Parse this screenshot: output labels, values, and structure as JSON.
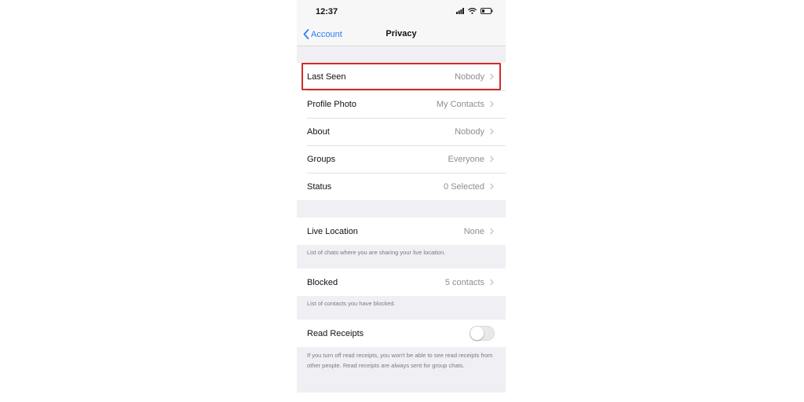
{
  "status_bar": {
    "time": "12:37"
  },
  "nav": {
    "back_label": "Account",
    "title": "Privacy"
  },
  "rows_group1": [
    {
      "label": "Last Seen",
      "value": "Nobody"
    },
    {
      "label": "Profile Photo",
      "value": "My Contacts"
    },
    {
      "label": "About",
      "value": "Nobody"
    },
    {
      "label": "Groups",
      "value": "Everyone"
    },
    {
      "label": "Status",
      "value": "0 Selected"
    }
  ],
  "live_location": {
    "label": "Live Location",
    "value": "None",
    "note": "List of chats where you are sharing your live location."
  },
  "blocked": {
    "label": "Blocked",
    "value": "5 contacts",
    "note": "List of contacts you have blocked."
  },
  "read_receipts": {
    "label": "Read Receipts",
    "enabled": false,
    "note": "If you turn off read receipts, you won't be able to see read receipts from other people. Read receipts are always sent for group chats."
  },
  "colors": {
    "accent": "#2f7bf5",
    "highlight": "#d42a2a"
  }
}
